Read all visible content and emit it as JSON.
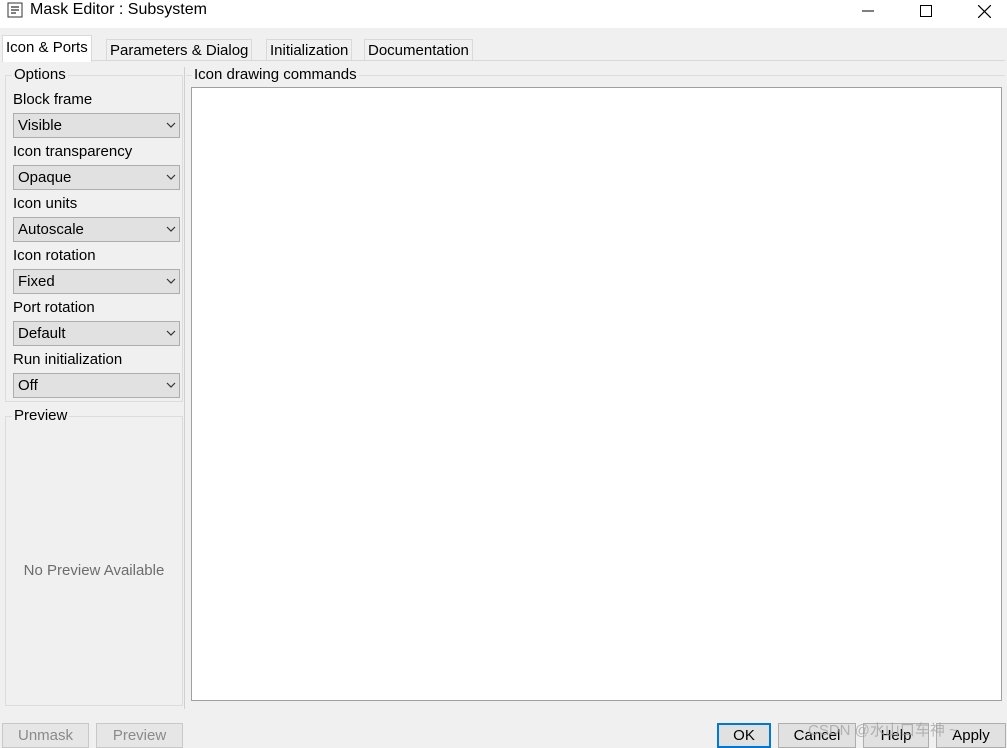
{
  "window": {
    "title": "Mask Editor : Subsystem",
    "app_icon": "matlab-block-icon",
    "controls": [
      "minimize-icon",
      "maximize-icon",
      "close-icon"
    ]
  },
  "tabs": [
    {
      "label": "Icon & Ports",
      "active": true
    },
    {
      "label": "Parameters & Dialog",
      "active": false
    },
    {
      "label": "Initialization",
      "active": false
    },
    {
      "label": "Documentation",
      "active": false
    }
  ],
  "options": {
    "legend": "Options",
    "fields": [
      {
        "label": "Block frame",
        "value": "Visible"
      },
      {
        "label": "Icon transparency",
        "value": "Opaque"
      },
      {
        "label": "Icon units",
        "value": "Autoscale"
      },
      {
        "label": "Icon rotation",
        "value": "Fixed"
      },
      {
        "label": "Port rotation",
        "value": "Default"
      },
      {
        "label": "Run initialization",
        "value": "Off"
      }
    ]
  },
  "preview": {
    "legend": "Preview",
    "empty_text": "No Preview Available"
  },
  "drawing": {
    "legend": "Icon drawing commands",
    "value": ""
  },
  "buttons": {
    "unmask": "Unmask",
    "preview": "Preview",
    "ok": "OK",
    "cancel": "Cancel",
    "help": "Help",
    "apply": "Apply"
  },
  "watermark": "CSDN @水山口车神 ~",
  "colors": {
    "focus_border": "#0078d7",
    "window_bg": "#f0f0f0"
  }
}
